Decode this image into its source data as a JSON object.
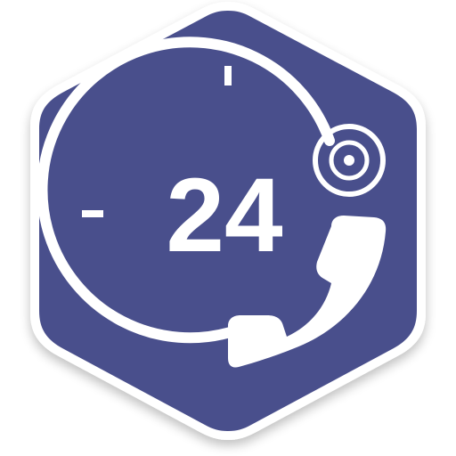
{
  "icon": {
    "badge_number": "24",
    "depicts": [
      "hexagon-badge",
      "clock-ring",
      "phone-handset-icon",
      "record-target-icon"
    ]
  },
  "colors": {
    "hexagon_fill": "#4a4f8c",
    "hexagon_border": "#ffffff",
    "foreground": "#ffffff",
    "shadow": "#c8c8d2"
  }
}
